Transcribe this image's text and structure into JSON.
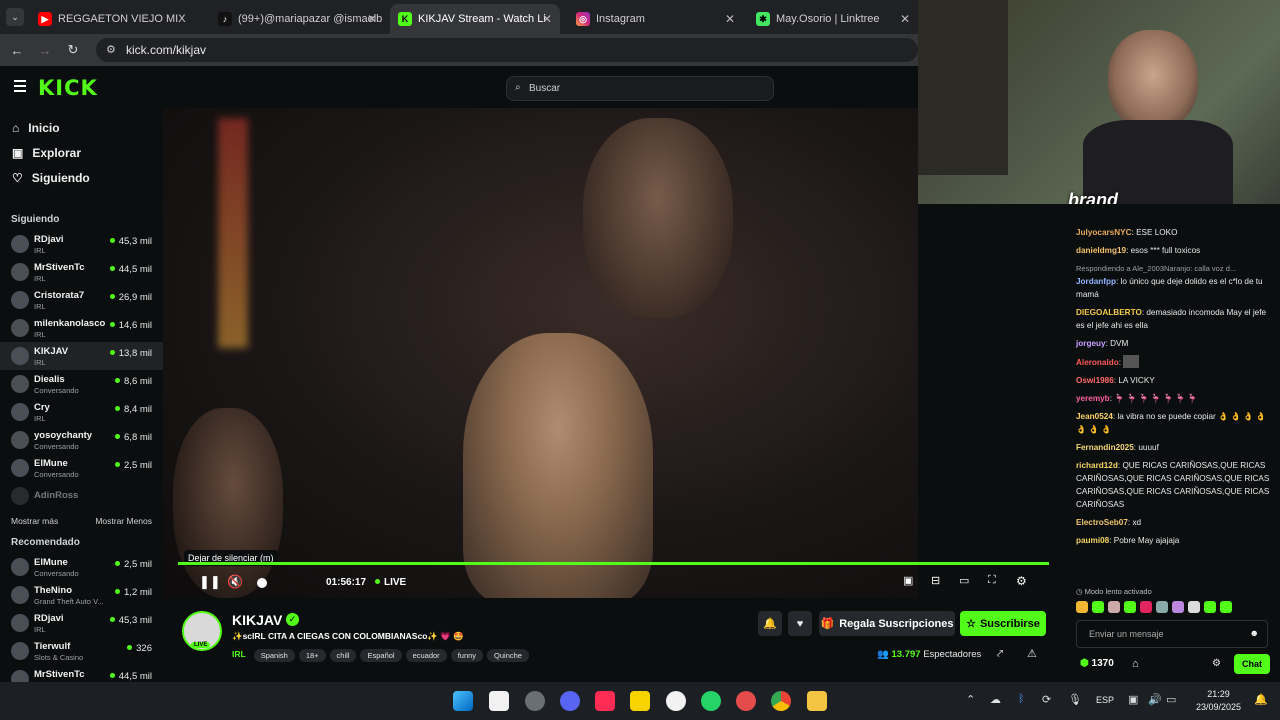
{
  "browser": {
    "tabs": [
      {
        "title": "REGGAETON VIEJO MIX",
        "icon": "youtube-icon"
      },
      {
        "title": "(99+)@mariapazar @ismaelb",
        "icon": "tiktok-icon"
      },
      {
        "title": "KIKJAV Stream - Watch Li",
        "icon": "kick-icon"
      },
      {
        "title": "Instagram",
        "icon": "instagram-icon"
      },
      {
        "title": "May.Osorio | Linktree",
        "icon": "linktree-icon"
      }
    ],
    "url": "kick.com/kikjav"
  },
  "header": {
    "logo": "KICK",
    "search_placeholder": "Buscar"
  },
  "sidebar": {
    "nav": [
      {
        "label": "Inicio",
        "icon": "home-icon"
      },
      {
        "label": "Explorar",
        "icon": "compass-icon"
      },
      {
        "label": "Siguiendo",
        "icon": "heart-icon"
      }
    ],
    "following_title": "Siguiendo",
    "following": [
      {
        "name": "RDjavi",
        "category": "IRL",
        "viewers": "45,3 mil"
      },
      {
        "name": "MrStivenTc",
        "category": "IRL",
        "viewers": "44,5 mil"
      },
      {
        "name": "Cristorata7",
        "category": "IRL",
        "viewers": "26,9 mil"
      },
      {
        "name": "milenkanolasco",
        "category": "IRL",
        "viewers": "14,6 mil"
      },
      {
        "name": "KIKJAV",
        "category": "IRL",
        "viewers": "13,8 mil"
      },
      {
        "name": "Diealis",
        "category": "Conversando",
        "viewers": "8,6 mil"
      },
      {
        "name": "Cry",
        "category": "IRL",
        "viewers": "8,4 mil"
      },
      {
        "name": "yosoychanty",
        "category": "Conversando",
        "viewers": "6,8 mil"
      },
      {
        "name": "ElMune",
        "category": "Conversando",
        "viewers": "2,5 mil"
      }
    ],
    "offline": "AdinRoss",
    "show_more": "Mostrar más",
    "show_less": "Mostrar Menos",
    "recommended_title": "Recomendado",
    "recommended": [
      {
        "name": "ElMune",
        "category": "Conversando",
        "viewers": "2,5 mil"
      },
      {
        "name": "TheNino",
        "category": "Grand Theft Auto V...",
        "viewers": "1,2 mil"
      },
      {
        "name": "RDjavi",
        "category": "IRL",
        "viewers": "45,3 mil"
      },
      {
        "name": "Tierwulf",
        "category": "Slots & Casino",
        "viewers": "326"
      },
      {
        "name": "MrStivenTc",
        "category": "IRL",
        "viewers": "44,5 mil"
      }
    ]
  },
  "player": {
    "tooltip": "Dejar de silenciar (m)",
    "time": "01:56:17",
    "live": "LIVE"
  },
  "stream": {
    "channel": "KIKJAV",
    "live_badge": "LIVE",
    "title": "✨scIRL CITA A CIEGAS CON COLOMBIANASco✨ 💗 🤩",
    "category": "IRL",
    "tags": [
      "Spanish",
      "18+",
      "chill",
      "Español",
      "ecuador",
      "funny",
      "Quinche"
    ],
    "gift_label": "Regala Suscripciones",
    "subscribe_label": "Suscribirse",
    "viewers": "13.797",
    "viewers_label": "Espectadores"
  },
  "chat": {
    "messages": [
      {
        "user": "JulyocarsNYC",
        "text": "ESE LOKO",
        "color": "#e7a85b"
      },
      {
        "user": "danieldmg19",
        "text": "esos *** full toxicos",
        "color": "#f5c26b"
      },
      {
        "reply": "Respondiendo a Ale_2003Naranjo: calla voz d...",
        "user": "Jordanfpp",
        "text": "lo único que deje dolido es el c*lo de tu mamá",
        "color": "#8fb3ff"
      },
      {
        "user": "DIEGOALBERTO",
        "text": "demasiado incomoda May el jefe es el jefe ahi es ella",
        "color": "#f2c94c"
      },
      {
        "user": "jorgeuy",
        "text": "DVM",
        "color": "#c7a0ff"
      },
      {
        "user": "Aleronaldo",
        "text": "",
        "color": "#ff5a5a"
      },
      {
        "user": "Oswi1986",
        "text": "LA VICKY",
        "color": "#ff6b6b"
      },
      {
        "user": "yeremyb",
        "text": "",
        "color": "#ff5f9e"
      },
      {
        "user": "Jean0524",
        "text": "la vibra no se puede copiar 👌 👌 👌 👌 👌 👌 👌",
        "color": "#ffd36b"
      },
      {
        "user": "Fernandin2025",
        "text": "uuuuf",
        "color": "#f7d774"
      },
      {
        "user": "richard12d",
        "text": "QUE RICAS CARIÑOSAS,QUE RICAS CARIÑOSAS,QUE RICAS CARIÑOSAS,QUE RICAS CARIÑOSAS,QUE RICAS CARIÑOSAS,QUE RICAS CARIÑOSAS",
        "color": "#f6d365"
      },
      {
        "user": "ElectroSeb07",
        "text": "xd",
        "color": "#f0c36d"
      },
      {
        "user": "paumi08",
        "text": "Pobre May ajajaja",
        "color": "#f6d365"
      }
    ],
    "slow_mode": "Modo lento activado",
    "input_placeholder": "Enviar un mensaje",
    "points": "1370",
    "chat_button": "Chat"
  },
  "taskbar": {
    "lang": "ESP",
    "time": "21:29",
    "date": "23/09/2025"
  },
  "colors": {
    "accent": "#53fc18",
    "bg": "#0b0e0f"
  }
}
